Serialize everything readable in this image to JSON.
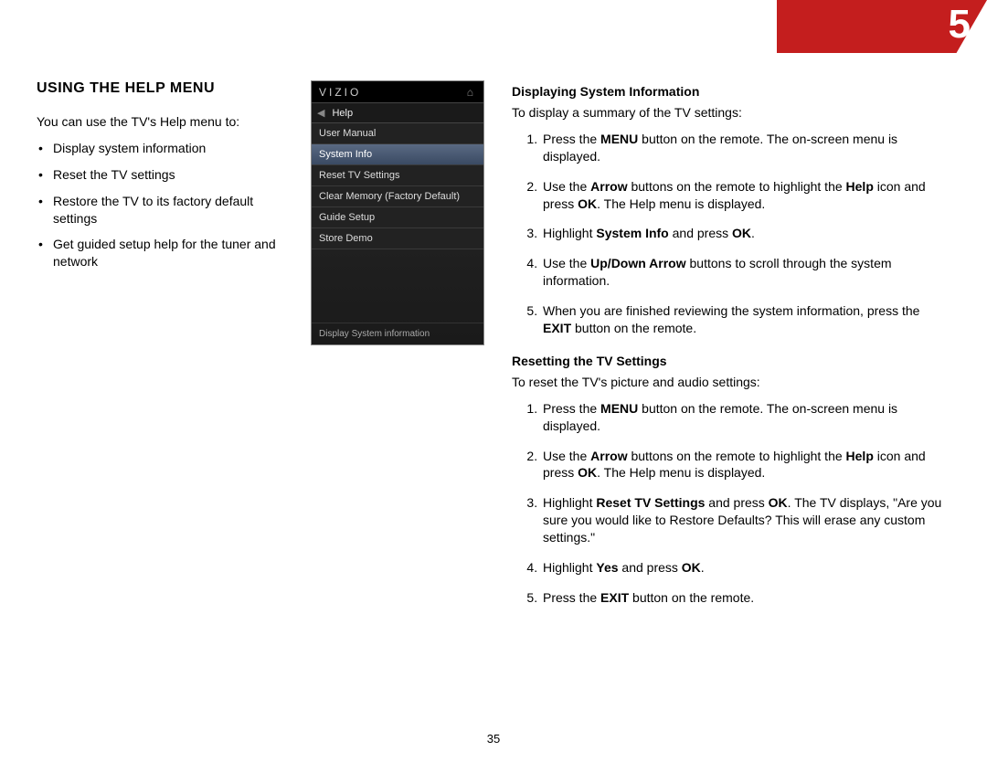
{
  "chapter": "5",
  "page_number": "35",
  "left": {
    "heading": "USING THE HELP MENU",
    "intro": "You can use the TV's Help menu to:",
    "bullets": [
      "Display system information",
      "Reset the TV settings",
      "Restore the TV to its factory default settings",
      "Get guided setup help for the tuner and network"
    ]
  },
  "screenshot": {
    "brand": "VIZIO",
    "help_label": "Help",
    "items": [
      "User Manual",
      "System Info",
      "Reset TV Settings",
      "Clear Memory (Factory Default)",
      "Guide Setup",
      "Store Demo"
    ],
    "selected_index": 1,
    "footer": "Display System information"
  },
  "sectionA": {
    "heading": "Displaying System Information",
    "intro": "To display a summary of the TV settings:",
    "steps": [
      {
        "pre": "Press the ",
        "b1": "MENU",
        "post1": " button on the remote. The on-screen menu is displayed."
      },
      {
        "pre": "Use the ",
        "b1": "Arrow",
        "mid1": " buttons on the remote to highlight the ",
        "b2": "Help",
        "mid2": " icon and press ",
        "b3": "OK",
        "post": ". The Help menu is displayed."
      },
      {
        "pre": "Highlight ",
        "b1": "System Info",
        "mid1": " and press ",
        "b2": "OK",
        "post": "."
      },
      {
        "pre": "Use the ",
        "b1": "Up/Down Arrow",
        "post1": " buttons to scroll through the system information."
      },
      {
        "pre": "When you are finished reviewing the system information, press the ",
        "b1": "EXIT",
        "post1": " button on the remote."
      }
    ]
  },
  "sectionB": {
    "heading": "Resetting the TV Settings",
    "intro": "To reset the TV's picture and audio settings:",
    "steps": [
      {
        "pre": "Press the ",
        "b1": "MENU",
        "post1": " button on the remote. The on-screen menu is displayed."
      },
      {
        "pre": "Use the ",
        "b1": "Arrow",
        "mid1": " buttons on the remote to highlight the ",
        "b2": "Help",
        "mid2": " icon and press ",
        "b3": "OK",
        "post": ". The Help menu is displayed."
      },
      {
        "pre": "Highlight ",
        "b1": "Reset TV Settings",
        "mid1": " and press ",
        "b2": "OK",
        "post": ". The TV displays, \"Are you sure you would like to Restore Defaults? This will erase any custom settings.\""
      },
      {
        "pre": "Highlight ",
        "b1": "Yes",
        "mid1": " and press ",
        "b2": "OK",
        "post": "."
      },
      {
        "pre": "Press the ",
        "b1": "EXIT",
        "post1": " button on the remote."
      }
    ]
  }
}
